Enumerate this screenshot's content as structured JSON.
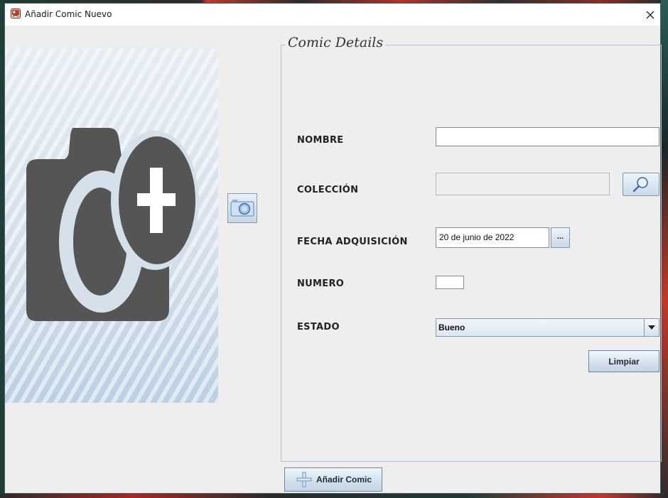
{
  "window": {
    "title": "Añadir Comic Nuevo",
    "close_icon": "close-icon",
    "app_icon": "app-comic-icon"
  },
  "image_panel": {
    "icon": "camera-plus-icon",
    "photo_button_icon": "camera-icon"
  },
  "details": {
    "title": "Comic Details",
    "nombre": {
      "label": "NOMBRE",
      "value": ""
    },
    "coleccion": {
      "label": "COLECCIÓN",
      "value": "",
      "search_icon": "magnifier-icon"
    },
    "fecha": {
      "label": "FECHA ADQUISICIÓN",
      "value": "20 de junio de 2022",
      "button_label": "..."
    },
    "numero": {
      "label": "NUMERO",
      "value": ""
    },
    "estado": {
      "label": "ESTADO",
      "selected": "Bueno",
      "arrow_icon": "chevron-down-icon"
    },
    "clear_label": "Limpiar"
  },
  "footer": {
    "add_label": "Añadir Comic",
    "add_icon": "plus-icon"
  },
  "colors": {
    "accent": "#7f98ad",
    "panel_border": "#aac3d6",
    "icon_dark": "#555555"
  }
}
